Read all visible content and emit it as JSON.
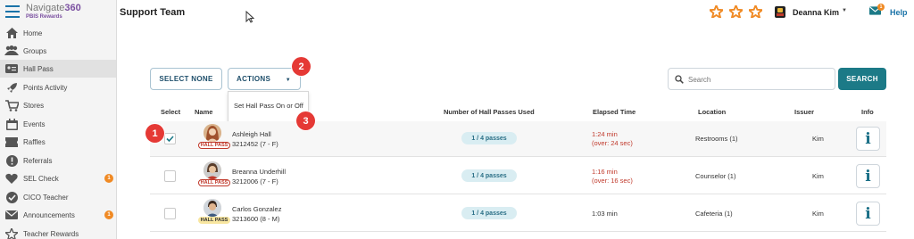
{
  "brand": {
    "name_plain": "Navigate",
    "name_bold": "360",
    "subtitle": "PBIS Rewards"
  },
  "sidebar": {
    "items": [
      {
        "label": "Home",
        "icon": "home-icon"
      },
      {
        "label": "Groups",
        "icon": "groups-icon"
      },
      {
        "label": "Hall Pass",
        "icon": "hall-pass-icon",
        "active": true
      },
      {
        "label": "Points Activity",
        "icon": "rocket-icon"
      },
      {
        "label": "Stores",
        "icon": "cart-icon"
      },
      {
        "label": "Events",
        "icon": "calendar-icon"
      },
      {
        "label": "Raffles",
        "icon": "ticket-icon"
      },
      {
        "label": "Referrals",
        "icon": "alert-icon"
      },
      {
        "label": "SEL Check",
        "icon": "heart-icon",
        "badge": "1"
      },
      {
        "label": "CICO Teacher",
        "icon": "check-circle-icon"
      },
      {
        "label": "Announcements",
        "icon": "envelope-icon",
        "badge": "1"
      },
      {
        "label": "Teacher Rewards",
        "icon": "star-icon"
      }
    ]
  },
  "header": {
    "title": "Support Team",
    "user_name": "Deanna Kim",
    "mail_badge": "1",
    "help": "Help"
  },
  "toolbar": {
    "select_none": "SELECT NONE",
    "actions": "ACTIONS",
    "dropdown_item": "Set Hall Pass On or Off",
    "search_placeholder": "Search",
    "search_button": "SEARCH"
  },
  "table": {
    "headers": {
      "select": "Select",
      "name": "Name",
      "passes": "Number of Hall Passes Used",
      "elapsed": "Elapsed Time",
      "location": "Location",
      "issuer": "Issuer",
      "info": "Info"
    },
    "hall_pass_label": "HALL PASS",
    "rows": [
      {
        "name": "Ashleigh Hall",
        "id": "3212452 (7 - F)",
        "passes": "1 / 4 passes",
        "elapsed_1": "1:24 min",
        "elapsed_2": "(over: 24 sec)",
        "overtime": true,
        "location": "Restrooms (1)",
        "issuer": "Kim",
        "checked": true
      },
      {
        "name": "Breanna Underhill",
        "id": "3212006 (7 - F)",
        "passes": "1 / 4 passes",
        "elapsed_1": "1:16 min",
        "elapsed_2": "(over: 16 sec)",
        "overtime": true,
        "location": "Counselor (1)",
        "issuer": "Kim",
        "checked": false
      },
      {
        "name": "Carlos Gonzalez",
        "id": "3213600 (8 - M)",
        "passes": "1 / 4 passes",
        "elapsed_1": "1:03 min",
        "elapsed_2": "",
        "overtime": false,
        "location": "Cafeteria (1)",
        "issuer": "Kim",
        "checked": false
      }
    ]
  },
  "callouts": [
    "1",
    "2",
    "3"
  ],
  "colors": {
    "accent": "#1c7a87",
    "brand_purple": "#7a4fa0",
    "overtime_red": "#c0392b",
    "star_orange": "#f08a24",
    "callout_red": "#e53935"
  }
}
